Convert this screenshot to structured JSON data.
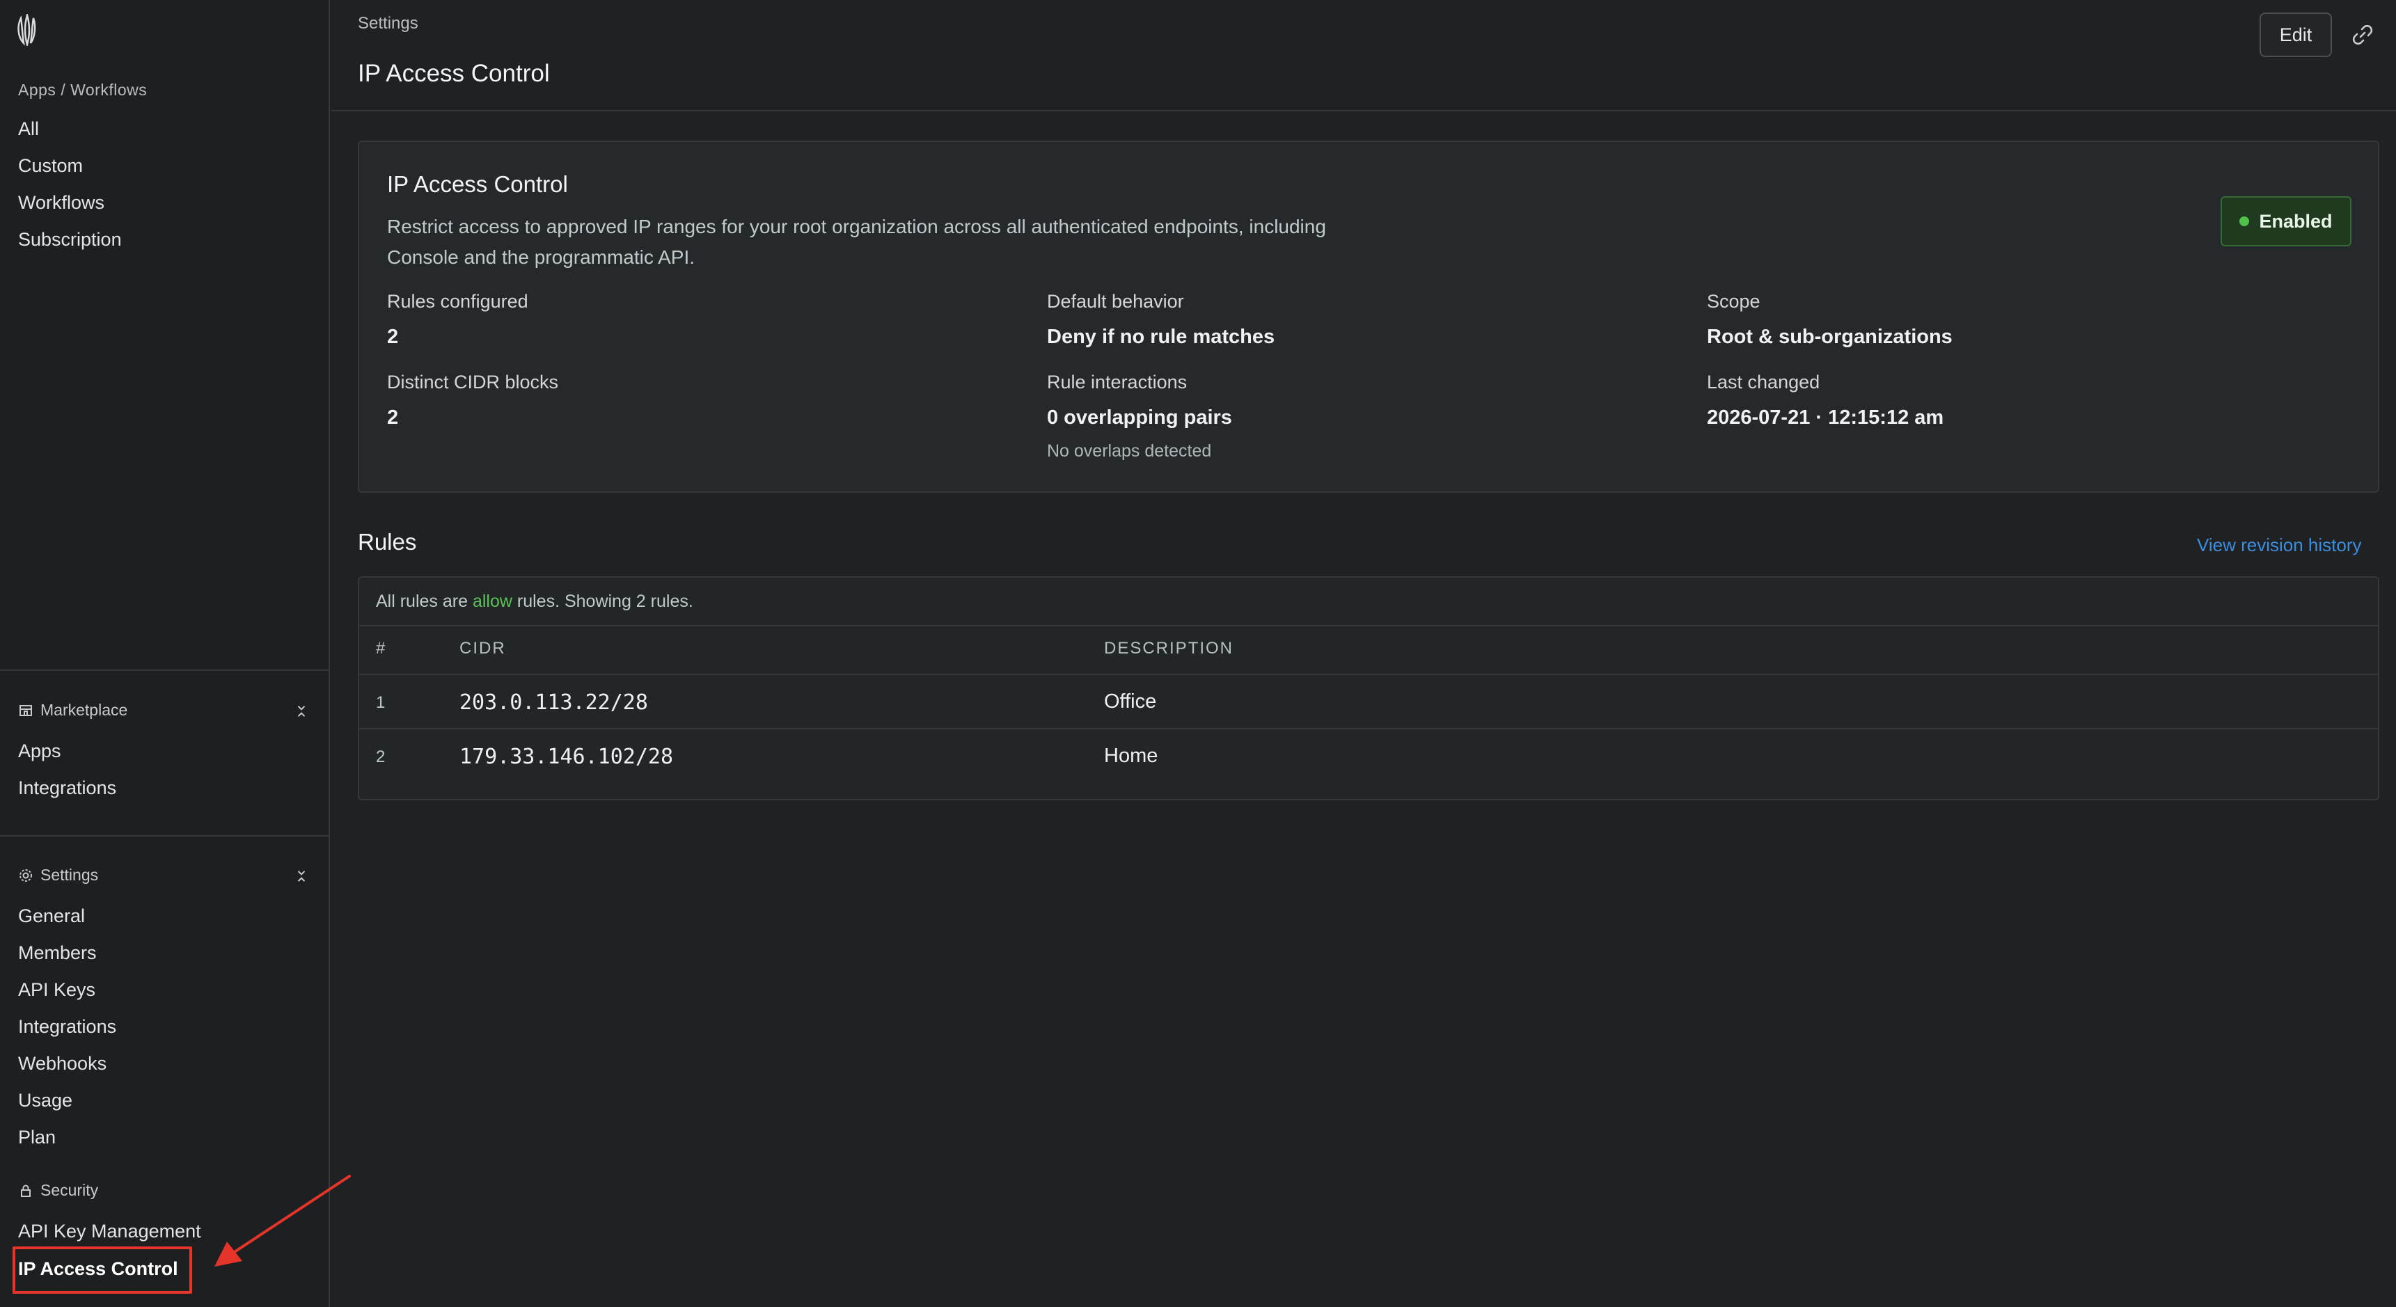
{
  "sidebar": {
    "apps_heading": "Apps / Workflows",
    "apps_items": [
      {
        "label": "All"
      },
      {
        "label": "Custom"
      },
      {
        "label": "Workflows"
      },
      {
        "label": "Subscription"
      }
    ],
    "marketplace": {
      "title": "Marketplace",
      "items": [
        {
          "label": "Apps"
        },
        {
          "label": "Integrations"
        }
      ]
    },
    "settings": {
      "title": "Settings",
      "items": [
        {
          "label": "General"
        },
        {
          "label": "Members"
        },
        {
          "label": "API Keys"
        },
        {
          "label": "Integrations"
        },
        {
          "label": "Webhooks"
        },
        {
          "label": "Usage"
        },
        {
          "label": "Plan"
        }
      ]
    },
    "security": {
      "title": "Security",
      "items": [
        {
          "label": "API Key Management"
        },
        {
          "label": "IP Access Control"
        }
      ]
    }
  },
  "header": {
    "breadcrumb": "Settings",
    "title": "IP Access Control",
    "edit_label": "Edit"
  },
  "card": {
    "title": "IP Access Control",
    "description": "Restrict access to approved IP ranges for your root organization across all authenticated endpoints, including Console and the programmatic API.",
    "status": "Enabled",
    "stats": {
      "rules_configured": {
        "label": "Rules configured",
        "value": "2"
      },
      "default_behavior": {
        "label": "Default behavior",
        "value": "Deny if no rule matches"
      },
      "scope": {
        "label": "Scope",
        "value": "Root & sub-organizations"
      },
      "cidr_blocks": {
        "label": "Distinct CIDR blocks",
        "value": "2"
      },
      "rule_interactions": {
        "label": "Rule interactions",
        "value": "0 overlapping pairs",
        "sub": "No overlaps detected"
      },
      "last_changed": {
        "label": "Last changed",
        "value": "2026-07-21 · 12:15:12 am"
      }
    }
  },
  "rules": {
    "title": "Rules",
    "revision_link": "View revision history",
    "note_prefix": "All rules are ",
    "note_allow": "allow",
    "note_suffix": " rules. Showing 2 rules.",
    "columns": {
      "num": "#",
      "cidr": "CIDR",
      "description": "DESCRIPTION"
    },
    "rows": [
      {
        "num": "1",
        "cidr": "203.0.113.22/28",
        "description": "Office"
      },
      {
        "num": "2",
        "cidr": "179.33.146.102/28",
        "description": "Home"
      }
    ]
  },
  "colors": {
    "accent_link": "#3b8de0",
    "enabled_green": "#4fc24a",
    "annotation_red": "#e5352b"
  },
  "icons": [
    "logo-icon",
    "storefront-icon",
    "gear-icon",
    "lock-icon",
    "collapse-icon",
    "link-icon"
  ]
}
